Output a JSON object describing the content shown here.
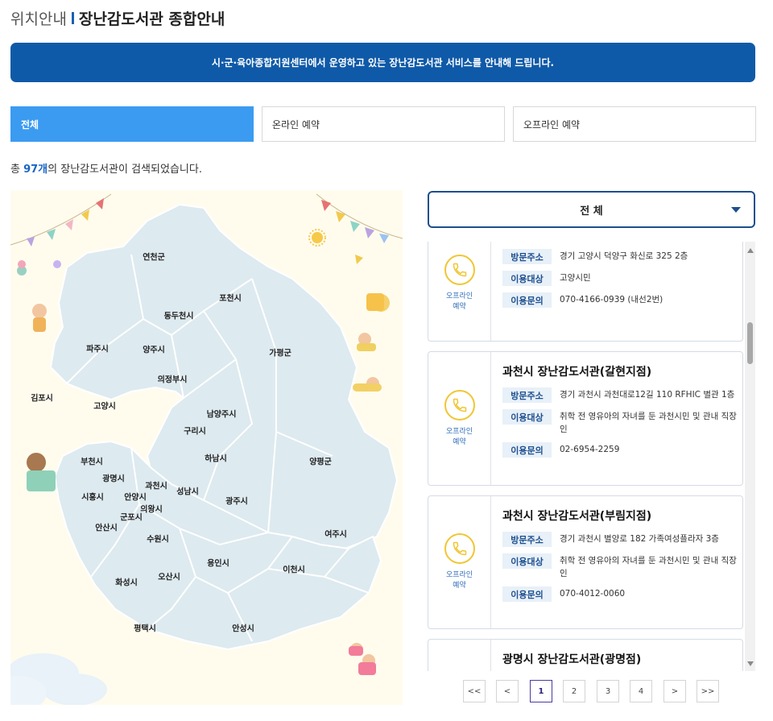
{
  "header": {
    "prefix": "위치안내",
    "title": "장난감도서관 종합안내"
  },
  "banner": {
    "text": "시·군·육아종합지원센터에서 운영하고 있는 장난감도서관 서비스를 안내해 드립니다."
  },
  "tabs": [
    {
      "label": "전체",
      "active": true
    },
    {
      "label": "온라인 예약",
      "active": false
    },
    {
      "label": "오프라인 예약",
      "active": false
    }
  ],
  "result": {
    "prefix": "총 ",
    "count": "97개",
    "suffix": "의 장난감도서관이 검색되었습니다."
  },
  "map": {
    "regions": [
      {
        "name": "연천군"
      },
      {
        "name": "포천시"
      },
      {
        "name": "동두천시"
      },
      {
        "name": "파주시"
      },
      {
        "name": "양주시"
      },
      {
        "name": "가평군"
      },
      {
        "name": "의정부시"
      },
      {
        "name": "김포시"
      },
      {
        "name": "고양시"
      },
      {
        "name": "남양주시"
      },
      {
        "name": "구리시"
      },
      {
        "name": "부천시"
      },
      {
        "name": "하남시"
      },
      {
        "name": "양평군"
      },
      {
        "name": "광명시"
      },
      {
        "name": "과천시"
      },
      {
        "name": "시흥시"
      },
      {
        "name": "안양시"
      },
      {
        "name": "성남시"
      },
      {
        "name": "의왕시"
      },
      {
        "name": "광주시"
      },
      {
        "name": "군포시"
      },
      {
        "name": "안산시"
      },
      {
        "name": "여주시"
      },
      {
        "name": "수원시"
      },
      {
        "name": "용인시"
      },
      {
        "name": "이천시"
      },
      {
        "name": "화성시"
      },
      {
        "name": "오산시"
      },
      {
        "name": "평택시"
      },
      {
        "name": "안성시"
      }
    ]
  },
  "filter": {
    "selected": "전 체"
  },
  "labels": {
    "address": "방문주소",
    "target": "이용대상",
    "contact": "이용문의"
  },
  "cards": [
    {
      "title": "",
      "type": "오프라인 예약",
      "address": "경기 고양시 덕양구 화신로 325 2층",
      "target": "고양시민",
      "contact": "070-4166-0939 (내선2번)"
    },
    {
      "title": "과천시 장난감도서관(갈현지점)",
      "type": "오프라인 예약",
      "address": "경기 과천시 과천대로12길 110 RFHIC 별관 1층",
      "target": "취학 전 영유아의 자녀를 둔 과천시민 및 관내 직장인",
      "contact": "02-6954-2259"
    },
    {
      "title": "과천시 장난감도서관(부림지점)",
      "type": "오프라인 예약",
      "address": "경기 과천시 별양로 182 가족여성플라자 3층",
      "target": "취학 전 영유아의 자녀를 둔 과천시민 및 관내 직장인",
      "contact": "070-4012-0060"
    },
    {
      "title": "광명시 장난감도서관(광명점)",
      "type": "",
      "address": "",
      "target": "",
      "contact": ""
    }
  ],
  "pagination": {
    "first": "<<",
    "prev": "<",
    "pages": [
      "1",
      "2",
      "3",
      "4"
    ],
    "current": "1",
    "next": ">",
    "last": ">>"
  },
  "colors": {
    "primary": "#0f5aa8",
    "tab_active": "#3b9bf1",
    "accent_yellow": "#f0c634",
    "label_bg": "#e8f0f8"
  }
}
